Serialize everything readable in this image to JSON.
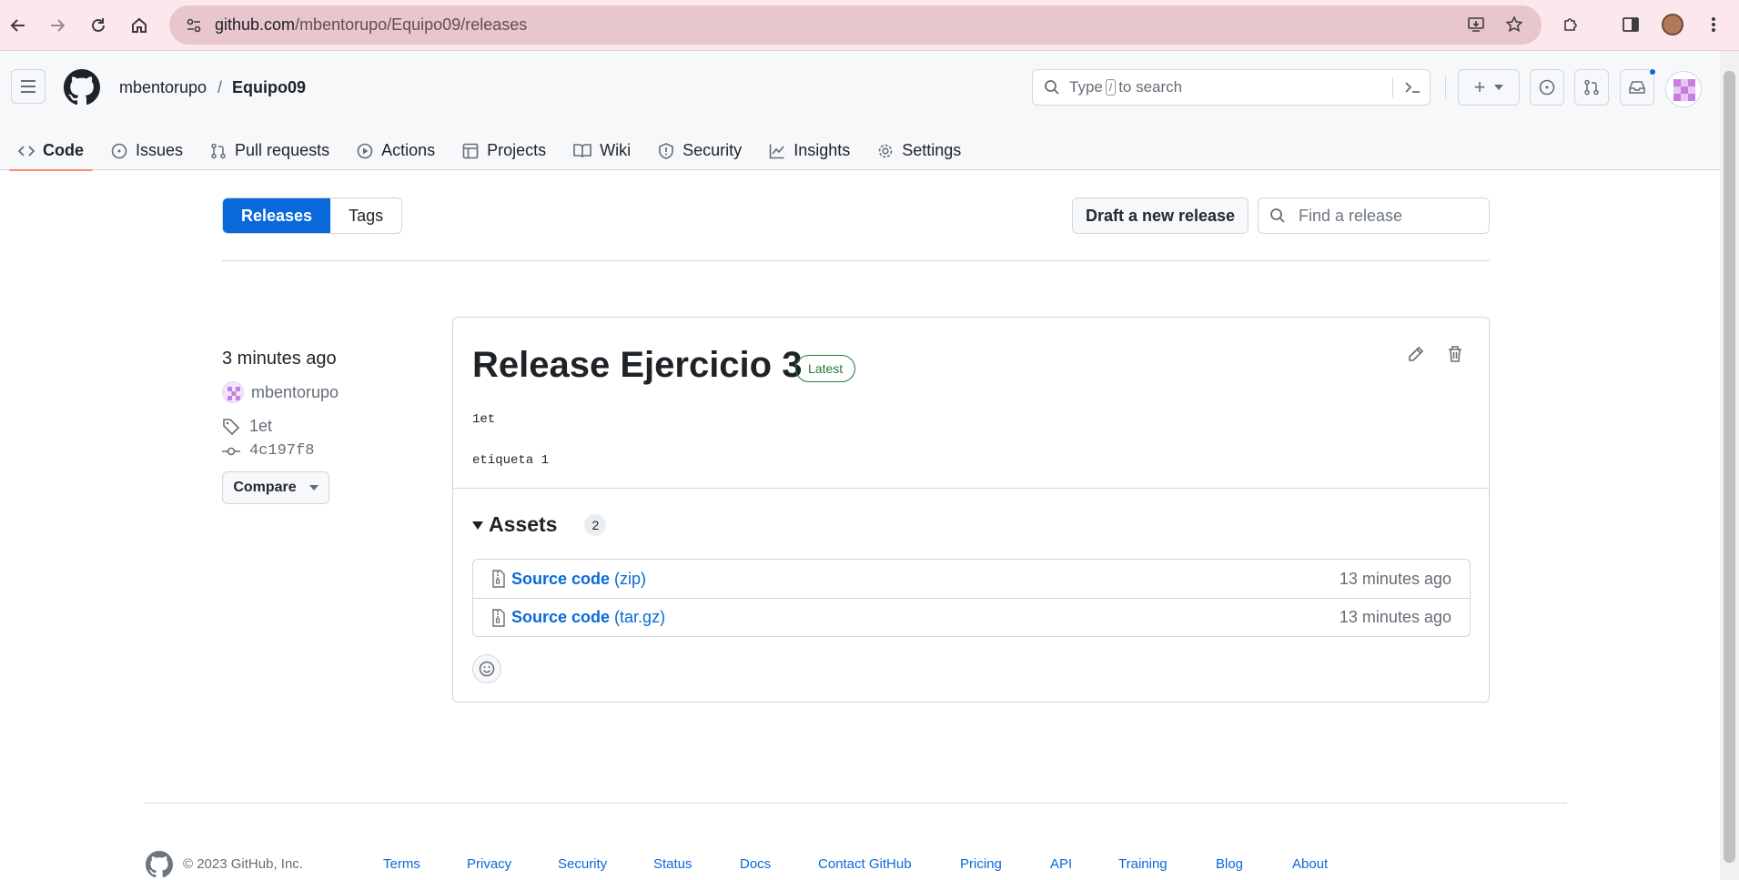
{
  "browser": {
    "url_host": "github.com",
    "url_path": "/mbentorupo/Equipo09/releases"
  },
  "header": {
    "owner": "mbentorupo",
    "separator": "/",
    "repo": "Equipo09",
    "search_prefix": "Type",
    "search_key": "/",
    "search_suffix": "to search",
    "plus_label": "+"
  },
  "tabs": [
    {
      "label": "Code",
      "icon": "code-icon"
    },
    {
      "label": "Issues",
      "icon": "issue-icon"
    },
    {
      "label": "Pull requests",
      "icon": "pull-request-icon"
    },
    {
      "label": "Actions",
      "icon": "play-icon"
    },
    {
      "label": "Projects",
      "icon": "table-icon"
    },
    {
      "label": "Wiki",
      "icon": "book-icon"
    },
    {
      "label": "Security",
      "icon": "shield-icon"
    },
    {
      "label": "Insights",
      "icon": "graph-icon"
    },
    {
      "label": "Settings",
      "icon": "gear-icon"
    }
  ],
  "subnav": {
    "releases": "Releases",
    "tags": "Tags",
    "draft_button": "Draft a new release",
    "find_placeholder": "Find a release"
  },
  "release": {
    "time": "3 minutes ago",
    "author": "mbentorupo",
    "tag": "1et",
    "commit": "4c197f8",
    "compare_label": "Compare",
    "title": "Release Ejercicio 3",
    "badge": "Latest",
    "body_line1": "1et",
    "body_line2": "etiqueta 1",
    "assets_label": "Assets",
    "assets_count": "2",
    "assets": [
      {
        "name": "Source code",
        "ext": "(zip)",
        "time": "13 minutes ago"
      },
      {
        "name": "Source code",
        "ext": "(tar.gz)",
        "time": "13 minutes ago"
      }
    ]
  },
  "footer": {
    "copyright": "© 2023 GitHub, Inc.",
    "links": [
      "Terms",
      "Privacy",
      "Security",
      "Status",
      "Docs",
      "Contact GitHub",
      "Pricing",
      "API",
      "Training",
      "Blog",
      "About"
    ]
  },
  "colors": {
    "accent_blue": "#0969da",
    "latest_green": "#1a7f37",
    "tab_underline": "#fd8c73",
    "browser_bar": "#fce8ec"
  }
}
